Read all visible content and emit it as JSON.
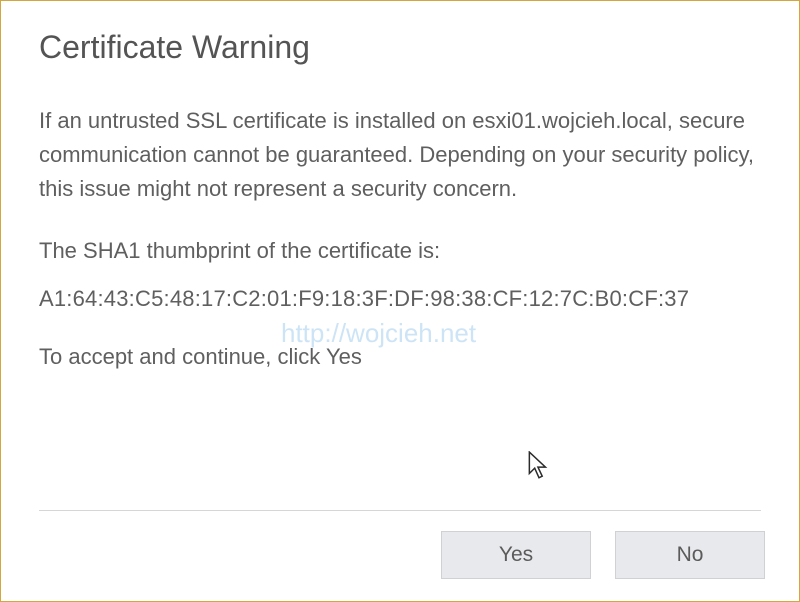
{
  "dialog": {
    "title": "Certificate Warning",
    "warning_text": "If an untrusted SSL certificate is installed on esxi01.wojcieh.local, secure communication cannot be guaranteed. Depending on your security policy, this issue might not represent a security concern.",
    "thumbprint_label": "The SHA1 thumbprint of the certificate is:",
    "thumbprint_value": "A1:64:43:C5:48:17:C2:01:F9:18:3F:DF:98:38:CF:12:7C:B0:CF:37",
    "accept_text": "To accept and continue, click Yes",
    "watermark": "http://wojcieh.net"
  },
  "buttons": {
    "yes": "Yes",
    "no": "No"
  }
}
